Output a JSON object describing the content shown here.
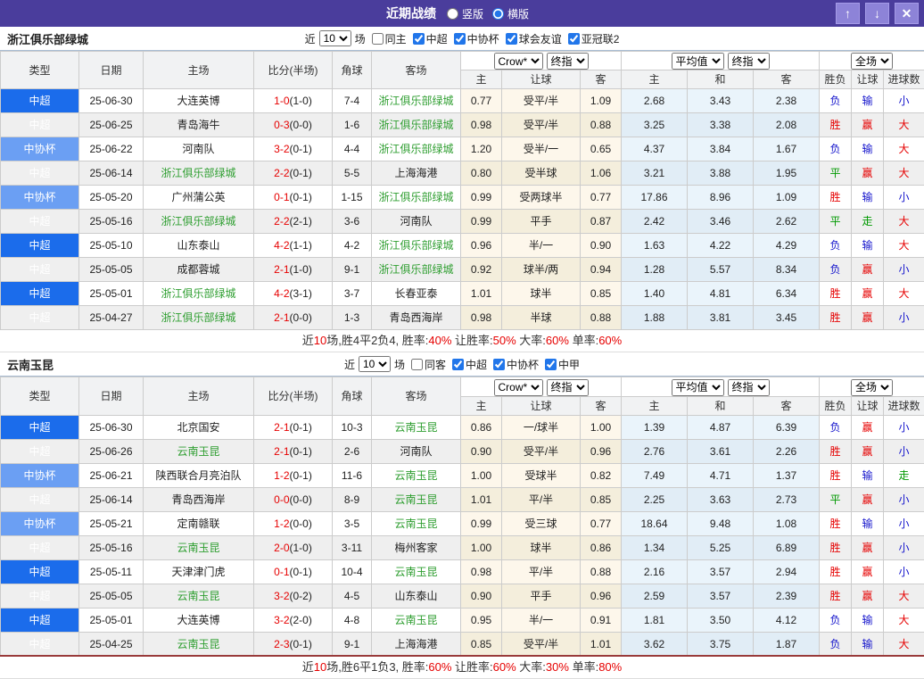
{
  "titlebar": {
    "title": "近期战绩",
    "views": [
      {
        "label": "竖版",
        "selected": false
      },
      {
        "label": "横版",
        "selected": true
      }
    ],
    "buttons": {
      "up_icon": "↑",
      "down_icon": "↓",
      "close_icon": "✕"
    }
  },
  "columns": {
    "type": "类型",
    "date": "日期",
    "home": "主场",
    "score": "比分(半场)",
    "corner": "角球",
    "away": "客场",
    "h": "主",
    "handicap": "让球",
    "a": "客",
    "avg_h": "主",
    "avg_d": "和",
    "avg_a": "客",
    "wl": "胜负",
    "hc": "让球",
    "goals": "进球数"
  },
  "colors": {
    "titlebar_bg": "#4a3d9c",
    "titlebar_button_bg": "#8d83d8",
    "type_csl_bg": "#1b6ceb",
    "type_cup_bg": "#6b9ff3",
    "focus_team_green": "#2e9e30",
    "score_red": "#e60000",
    "result_red": "#e60000",
    "result_blue": "#1414cc",
    "result_green": "#009900",
    "crow_col_bg": "#fdf7eb",
    "avg_col_bg": "#eaf4fb",
    "bottom_line": "#993a3a"
  },
  "sections": [
    {
      "team": "浙江俱乐部绿城",
      "filter": {
        "recent_label": "近",
        "count": "10",
        "unit_label": "场",
        "options": [
          {
            "label": "同主",
            "checked": false
          },
          {
            "label": "中超",
            "checked": true
          },
          {
            "label": "中协杯",
            "checked": true
          },
          {
            "label": "球会友谊",
            "checked": true
          },
          {
            "label": "亚冠联2",
            "checked": true
          }
        ]
      },
      "dropdowns": {
        "company": "Crow*",
        "company_time": "终指",
        "avg": "平均值",
        "avg_time": "终指",
        "scope": "全场"
      },
      "rows": [
        {
          "type": "中超",
          "date": "25-06-30",
          "home": "大连英博",
          "home_g": false,
          "score": "1-0",
          "half": "(1-0)",
          "corner": "7-4",
          "away": "浙江俱乐部绿城",
          "away_g": true,
          "h": "0.77",
          "line": "受平/半",
          "a": "1.09",
          "ah": "2.68",
          "ad": "3.43",
          "aa": "2.38",
          "wl": {
            "t": "负",
            "c": "b"
          },
          "hc": {
            "t": "输",
            "c": "b"
          },
          "ou": {
            "t": "小",
            "c": "b"
          }
        },
        {
          "type": "中超",
          "date": "25-06-25",
          "home": "青岛海牛",
          "home_g": false,
          "score": "0-3",
          "half": "(0-0)",
          "corner": "1-6",
          "away": "浙江俱乐部绿城",
          "away_g": true,
          "h": "0.98",
          "line": "受平/半",
          "a": "0.88",
          "ah": "3.25",
          "ad": "3.38",
          "aa": "2.08",
          "wl": {
            "t": "胜",
            "c": "r"
          },
          "hc": {
            "t": "赢",
            "c": "r"
          },
          "ou": {
            "t": "大",
            "c": "r"
          }
        },
        {
          "type": "中协杯",
          "date": "25-06-22",
          "home": "河南队",
          "home_g": false,
          "score": "3-2",
          "half": "(0-1)",
          "corner": "4-4",
          "away": "浙江俱乐部绿城",
          "away_g": true,
          "h": "1.20",
          "line": "受半/一",
          "a": "0.65",
          "ah": "4.37",
          "ad": "3.84",
          "aa": "1.67",
          "wl": {
            "t": "负",
            "c": "b"
          },
          "hc": {
            "t": "输",
            "c": "b"
          },
          "ou": {
            "t": "大",
            "c": "r"
          }
        },
        {
          "type": "中超",
          "date": "25-06-14",
          "home": "浙江俱乐部绿城",
          "home_g": true,
          "score": "2-2",
          "half": "(0-1)",
          "corner": "5-5",
          "away": "上海海港",
          "away_g": false,
          "h": "0.80",
          "line": "受半球",
          "a": "1.06",
          "ah": "3.21",
          "ad": "3.88",
          "aa": "1.95",
          "wl": {
            "t": "平",
            "c": "g"
          },
          "hc": {
            "t": "赢",
            "c": "r"
          },
          "ou": {
            "t": "大",
            "c": "r"
          }
        },
        {
          "type": "中协杯",
          "date": "25-05-20",
          "home": "广州蒲公英",
          "home_g": false,
          "score": "0-1",
          "half": "(0-1)",
          "corner": "1-15",
          "away": "浙江俱乐部绿城",
          "away_g": true,
          "h": "0.99",
          "line": "受两球半",
          "a": "0.77",
          "ah": "17.86",
          "ad": "8.96",
          "aa": "1.09",
          "wl": {
            "t": "胜",
            "c": "r"
          },
          "hc": {
            "t": "输",
            "c": "b"
          },
          "ou": {
            "t": "小",
            "c": "b"
          }
        },
        {
          "type": "中超",
          "date": "25-05-16",
          "home": "浙江俱乐部绿城",
          "home_g": true,
          "score": "2-2",
          "half": "(2-1)",
          "corner": "3-6",
          "away": "河南队",
          "away_g": false,
          "h": "0.99",
          "line": "平手",
          "a": "0.87",
          "ah": "2.42",
          "ad": "3.46",
          "aa": "2.62",
          "wl": {
            "t": "平",
            "c": "g"
          },
          "hc": {
            "t": "走",
            "c": "g"
          },
          "ou": {
            "t": "大",
            "c": "r"
          }
        },
        {
          "type": "中超",
          "date": "25-05-10",
          "home": "山东泰山",
          "home_g": false,
          "score": "4-2",
          "half": "(1-1)",
          "corner": "4-2",
          "away": "浙江俱乐部绿城",
          "away_g": true,
          "h": "0.96",
          "line": "半/一",
          "a": "0.90",
          "ah": "1.63",
          "ad": "4.22",
          "aa": "4.29",
          "wl": {
            "t": "负",
            "c": "b"
          },
          "hc": {
            "t": "输",
            "c": "b"
          },
          "ou": {
            "t": "大",
            "c": "r"
          }
        },
        {
          "type": "中超",
          "date": "25-05-05",
          "home": "成都蓉城",
          "home_g": false,
          "score": "2-1",
          "half": "(1-0)",
          "corner": "9-1",
          "away": "浙江俱乐部绿城",
          "away_g": true,
          "h": "0.92",
          "line": "球半/两",
          "a": "0.94",
          "ah": "1.28",
          "ad": "5.57",
          "aa": "8.34",
          "wl": {
            "t": "负",
            "c": "b"
          },
          "hc": {
            "t": "赢",
            "c": "r"
          },
          "ou": {
            "t": "小",
            "c": "b"
          }
        },
        {
          "type": "中超",
          "date": "25-05-01",
          "home": "浙江俱乐部绿城",
          "home_g": true,
          "score": "4-2",
          "half": "(3-1)",
          "corner": "3-7",
          "away": "长春亚泰",
          "away_g": false,
          "h": "1.01",
          "line": "球半",
          "a": "0.85",
          "ah": "1.40",
          "ad": "4.81",
          "aa": "6.34",
          "wl": {
            "t": "胜",
            "c": "r"
          },
          "hc": {
            "t": "赢",
            "c": "r"
          },
          "ou": {
            "t": "大",
            "c": "r"
          }
        },
        {
          "type": "中超",
          "date": "25-04-27",
          "home": "浙江俱乐部绿城",
          "home_g": true,
          "score": "2-1",
          "half": "(0-0)",
          "corner": "1-3",
          "away": "青岛西海岸",
          "away_g": false,
          "h": "0.98",
          "line": "半球",
          "a": "0.88",
          "ah": "1.88",
          "ad": "3.81",
          "aa": "3.45",
          "wl": {
            "t": "胜",
            "c": "r"
          },
          "hc": {
            "t": "赢",
            "c": "r"
          },
          "ou": {
            "t": "小",
            "c": "b"
          }
        }
      ],
      "summary": [
        {
          "t": "近",
          "red": false
        },
        {
          "t": "10",
          "red": true
        },
        {
          "t": "场,胜4平2负4, 胜率:",
          "red": false
        },
        {
          "t": "40%",
          "red": true
        },
        {
          "t": " 让胜率:",
          "red": false
        },
        {
          "t": "50%",
          "red": true
        },
        {
          "t": " 大率:",
          "red": false
        },
        {
          "t": "60%",
          "red": true
        },
        {
          "t": " 单率:",
          "red": false
        },
        {
          "t": "60%",
          "red": true
        }
      ]
    },
    {
      "team": "云南玉昆",
      "filter": {
        "recent_label": "近",
        "count": "10",
        "unit_label": "场",
        "options": [
          {
            "label": "同客",
            "checked": false
          },
          {
            "label": "中超",
            "checked": true
          },
          {
            "label": "中协杯",
            "checked": true
          },
          {
            "label": "中甲",
            "checked": true
          }
        ]
      },
      "dropdowns": {
        "company": "Crow*",
        "company_time": "终指",
        "avg": "平均值",
        "avg_time": "终指",
        "scope": "全场"
      },
      "rows": [
        {
          "type": "中超",
          "date": "25-06-30",
          "home": "北京国安",
          "home_g": false,
          "score": "2-1",
          "half": "(0-1)",
          "corner": "10-3",
          "away": "云南玉昆",
          "away_g": true,
          "h": "0.86",
          "line": "一/球半",
          "a": "1.00",
          "ah": "1.39",
          "ad": "4.87",
          "aa": "6.39",
          "wl": {
            "t": "负",
            "c": "b"
          },
          "hc": {
            "t": "赢",
            "c": "r"
          },
          "ou": {
            "t": "小",
            "c": "b"
          }
        },
        {
          "type": "中超",
          "date": "25-06-26",
          "home": "云南玉昆",
          "home_g": true,
          "score": "2-1",
          "half": "(0-1)",
          "corner": "2-6",
          "away": "河南队",
          "away_g": false,
          "h": "0.90",
          "line": "受平/半",
          "a": "0.96",
          "ah": "2.76",
          "ad": "3.61",
          "aa": "2.26",
          "wl": {
            "t": "胜",
            "c": "r"
          },
          "hc": {
            "t": "赢",
            "c": "r"
          },
          "ou": {
            "t": "小",
            "c": "b"
          }
        },
        {
          "type": "中协杯",
          "date": "25-06-21",
          "home": "陕西联合月亮泊队",
          "home_g": false,
          "score": "1-2",
          "half": "(0-1)",
          "corner": "11-6",
          "away": "云南玉昆",
          "away_g": true,
          "h": "1.00",
          "line": "受球半",
          "a": "0.82",
          "ah": "7.49",
          "ad": "4.71",
          "aa": "1.37",
          "wl": {
            "t": "胜",
            "c": "r"
          },
          "hc": {
            "t": "输",
            "c": "b"
          },
          "ou": {
            "t": "走",
            "c": "g"
          }
        },
        {
          "type": "中超",
          "date": "25-06-14",
          "home": "青岛西海岸",
          "home_g": false,
          "score": "0-0",
          "half": "(0-0)",
          "corner": "8-9",
          "away": "云南玉昆",
          "away_g": true,
          "h": "1.01",
          "line": "平/半",
          "a": "0.85",
          "ah": "2.25",
          "ad": "3.63",
          "aa": "2.73",
          "wl": {
            "t": "平",
            "c": "g"
          },
          "hc": {
            "t": "赢",
            "c": "r"
          },
          "ou": {
            "t": "小",
            "c": "b"
          }
        },
        {
          "type": "中协杯",
          "date": "25-05-21",
          "home": "定南赣联",
          "home_g": false,
          "score": "1-2",
          "half": "(0-0)",
          "corner": "3-5",
          "away": "云南玉昆",
          "away_g": true,
          "h": "0.99",
          "line": "受三球",
          "a": "0.77",
          "ah": "18.64",
          "ad": "9.48",
          "aa": "1.08",
          "wl": {
            "t": "胜",
            "c": "r"
          },
          "hc": {
            "t": "输",
            "c": "b"
          },
          "ou": {
            "t": "小",
            "c": "b"
          }
        },
        {
          "type": "中超",
          "date": "25-05-16",
          "home": "云南玉昆",
          "home_g": true,
          "score": "2-0",
          "half": "(1-0)",
          "corner": "3-11",
          "away": "梅州客家",
          "away_g": false,
          "h": "1.00",
          "line": "球半",
          "a": "0.86",
          "ah": "1.34",
          "ad": "5.25",
          "aa": "6.89",
          "wl": {
            "t": "胜",
            "c": "r"
          },
          "hc": {
            "t": "赢",
            "c": "r"
          },
          "ou": {
            "t": "小",
            "c": "b"
          }
        },
        {
          "type": "中超",
          "date": "25-05-11",
          "home": "天津津门虎",
          "home_g": false,
          "score": "0-1",
          "half": "(0-1)",
          "corner": "10-4",
          "away": "云南玉昆",
          "away_g": true,
          "h": "0.98",
          "line": "平/半",
          "a": "0.88",
          "ah": "2.16",
          "ad": "3.57",
          "aa": "2.94",
          "wl": {
            "t": "胜",
            "c": "r"
          },
          "hc": {
            "t": "赢",
            "c": "r"
          },
          "ou": {
            "t": "小",
            "c": "b"
          }
        },
        {
          "type": "中超",
          "date": "25-05-05",
          "home": "云南玉昆",
          "home_g": true,
          "score": "3-2",
          "half": "(0-2)",
          "corner": "4-5",
          "away": "山东泰山",
          "away_g": false,
          "h": "0.90",
          "line": "平手",
          "a": "0.96",
          "ah": "2.59",
          "ad": "3.57",
          "aa": "2.39",
          "wl": {
            "t": "胜",
            "c": "r"
          },
          "hc": {
            "t": "赢",
            "c": "r"
          },
          "ou": {
            "t": "大",
            "c": "r"
          }
        },
        {
          "type": "中超",
          "date": "25-05-01",
          "home": "大连英博",
          "home_g": false,
          "score": "3-2",
          "half": "(2-0)",
          "corner": "4-8",
          "away": "云南玉昆",
          "away_g": true,
          "h": "0.95",
          "line": "半/一",
          "a": "0.91",
          "ah": "1.81",
          "ad": "3.50",
          "aa": "4.12",
          "wl": {
            "t": "负",
            "c": "b"
          },
          "hc": {
            "t": "输",
            "c": "b"
          },
          "ou": {
            "t": "大",
            "c": "r"
          }
        },
        {
          "type": "中超",
          "date": "25-04-25",
          "home": "云南玉昆",
          "home_g": true,
          "score": "2-3",
          "half": "(0-1)",
          "corner": "9-1",
          "away": "上海海港",
          "away_g": false,
          "h": "0.85",
          "line": "受平/半",
          "a": "1.01",
          "ah": "3.62",
          "ad": "3.75",
          "aa": "1.87",
          "wl": {
            "t": "负",
            "c": "b"
          },
          "hc": {
            "t": "输",
            "c": "b"
          },
          "ou": {
            "t": "大",
            "c": "r"
          }
        }
      ],
      "summary": [
        {
          "t": "近",
          "red": false
        },
        {
          "t": "10",
          "red": true
        },
        {
          "t": "场,胜6平1负3, 胜率:",
          "red": false
        },
        {
          "t": "60%",
          "red": true
        },
        {
          "t": " 让胜率:",
          "red": false
        },
        {
          "t": "60%",
          "red": true
        },
        {
          "t": " 大率:",
          "red": false
        },
        {
          "t": "30%",
          "red": true
        },
        {
          "t": " 单率:",
          "red": false
        },
        {
          "t": "80%",
          "red": true
        }
      ]
    }
  ]
}
